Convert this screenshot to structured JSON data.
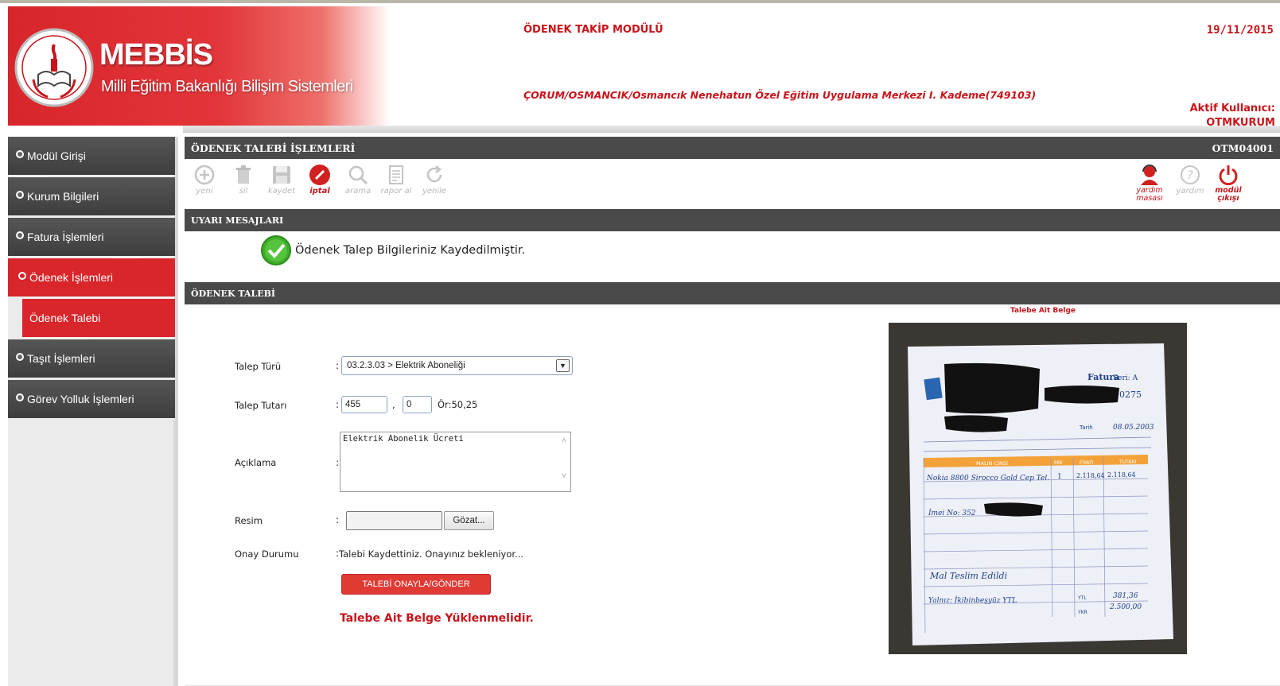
{
  "header": {
    "brand_title": "MEBBİS",
    "brand_subtitle": "Milli Eğitim Bakanlığı Bilişim Sistemleri",
    "module_title": "ÖDENEK TAKİP MODÜLÜ",
    "date": "19/11/2015",
    "institution": "ÇORUM/OSMANCIK/Osmancık Nenehatun Özel Eğitim Uygulama Merkezi I. Kademe(749103)",
    "active_user_label": "Aktif Kullanıcı:",
    "active_user_name": "OTMKURUM",
    "logo_ring_text": "T.C. MİLLİ EĞİTİM BAKANLIĞI"
  },
  "sidebar": {
    "items": [
      {
        "label": "Modül Girişi"
      },
      {
        "label": "Kurum Bilgileri"
      },
      {
        "label": "Fatura İşlemleri"
      },
      {
        "label": "Ödenek İşlemleri"
      },
      {
        "label": "Ödenek Talebi"
      },
      {
        "label": "Taşıt İşlemleri"
      },
      {
        "label": "Görev Yolluk İşlemleri"
      }
    ]
  },
  "page": {
    "title": "ÖDENEK TALEBİ İŞLEMLERİ",
    "code": "OTM04001"
  },
  "toolbar": {
    "tools": [
      {
        "label": "yeni",
        "icon": "plus-circle-icon"
      },
      {
        "label": "sil",
        "icon": "trash-icon"
      },
      {
        "label": "kaydet",
        "icon": "save-icon"
      },
      {
        "label": "iptal",
        "icon": "cancel-icon"
      },
      {
        "label": "arama",
        "icon": "search-icon"
      },
      {
        "label": "rapor al",
        "icon": "report-icon"
      },
      {
        "label": "yenile",
        "icon": "refresh-icon"
      }
    ],
    "right_tools": [
      {
        "label": "yardım masası",
        "icon": "helpdesk-icon"
      },
      {
        "label": "yardım",
        "icon": "help-icon"
      },
      {
        "label": "modül çıkışı",
        "icon": "power-icon"
      }
    ]
  },
  "warnings": {
    "title": "UYARI MESAJLARI",
    "message": "Ödenek Talep Bilgileriniz Kaydedilmiştir."
  },
  "form": {
    "section_title": "ÖDENEK TALEBİ",
    "attachment_caption": "Talebe Ait Belge",
    "talep_turu_label": "Talep Türü",
    "talep_turu_value": "03.2.3.03 > Elektrik Aboneliği",
    "talep_tutari_label": "Talep Tutarı",
    "amount_whole": "455",
    "amount_separator": ",",
    "amount_fraction": "0",
    "amount_hint": "Ör:50,25",
    "aciklama_label": "Açıklama",
    "aciklama_value": "Elektrik Abonelik Ücreti",
    "resim_label": "Resim",
    "browse_label": "Gözat...",
    "onay_label": "Onay Durumu",
    "onay_value": "Talebi Kaydettiniz. Onayınız bekleniyor...",
    "submit_label": "TALEBİ ONAYLA/GÖNDER",
    "warning_text": "Talebe Ait Belge Yüklenmelidir.",
    "colon": ":"
  },
  "invoice": {
    "title": "Fatura",
    "serial_label": "Seri: A",
    "serial_no": "0275",
    "date_label": "Tarih",
    "date_value": "08.05.2003",
    "columns": [
      "MALIN CİNSİ",
      "MİK",
      "FİYATI",
      "TUTARI"
    ],
    "row1": "Nokia 8800 Sirocco Gold Cep Tel.",
    "row1_qty": "1",
    "row1_price": "2.118,64",
    "row1_total": "2.118,64",
    "row2": "İmei No: 352",
    "note": "Mal Teslim Edildi",
    "total_words": "Yalnız: İkibinbeşyüz YTL",
    "kdv": "381,36",
    "grand_total": "2.500,00",
    "ytl": "YTL",
    "ykr": "YKR"
  }
}
